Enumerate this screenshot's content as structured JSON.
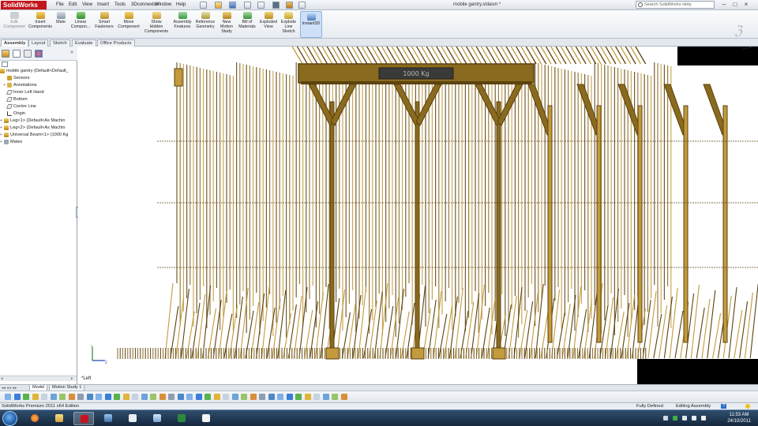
{
  "app": {
    "logo_text": "SolidWorks",
    "document_title": "mobile gantry.sldasm *",
    "menu": [
      "File",
      "Edit",
      "View",
      "Insert",
      "Tools",
      "3Dconnexion",
      "Window",
      "Help"
    ],
    "search_placeholder": "Search SolidWorks Help"
  },
  "ribbon": {
    "commands": [
      {
        "label": "Edit\nComponent",
        "disabled": true
      },
      {
        "label": "Insert\nComponents"
      },
      {
        "label": "Mate"
      },
      {
        "label": "Linear\nCompon..."
      },
      {
        "label": "Smart\nFasteners"
      },
      {
        "label": "Move\nComponent"
      },
      {
        "label": "Show\nHidden\nComponents"
      },
      {
        "label": "Assembly\nFeatures"
      },
      {
        "label": "Reference\nGeometry"
      },
      {
        "label": "New\nMotion\nStudy"
      },
      {
        "label": "Bill of\nMaterials"
      },
      {
        "label": "Exploded\nView"
      },
      {
        "label": "Explode\nLine\nSketch"
      },
      {
        "label": "Instant3D",
        "active": true
      }
    ]
  },
  "command_tabs": [
    "Assembly",
    "Layout",
    "Sketch",
    "Evaluate",
    "Office Products"
  ],
  "feature_tree": {
    "root": "mobile gantry  (Default<Default_",
    "items": [
      {
        "label": "Sensors",
        "icon": "sensor-icon",
        "expand": ""
      },
      {
        "label": "Annotations",
        "icon": "annotation-icon",
        "expand": "+"
      },
      {
        "label": "Inner Left Hand",
        "icon": "plane-icon",
        "expand": ""
      },
      {
        "label": "Bottom",
        "icon": "plane-icon",
        "expand": ""
      },
      {
        "label": "Centre Line",
        "icon": "plane-icon",
        "expand": ""
      },
      {
        "label": "Origin",
        "icon": "origin-icon",
        "expand": ""
      },
      {
        "label": "Leg<1> (Default<As Machin",
        "icon": "part-icon",
        "expand": "+"
      },
      {
        "label": "Leg<2> (Default<As Machin",
        "icon": "part-icon",
        "expand": "+"
      },
      {
        "label": "Universal Beam<1> (1000 Kg",
        "icon": "part-icon",
        "expand": "+"
      },
      {
        "label": "Mates",
        "icon": "mates-icon",
        "expand": "+"
      }
    ]
  },
  "viewport": {
    "view_name": "*Left",
    "beam_label": "1000 Kg"
  },
  "model_tabs": [
    "Model",
    "Motion Study 1"
  ],
  "status": {
    "edition": "SolidWorks Premium 2011 x64 Edition",
    "state": "Fully Defined",
    "mode": "Editing Assembly",
    "help": "?"
  },
  "taskbar": {
    "time": "11:53 AM",
    "date": "24/10/2011"
  },
  "colors": {
    "steel": "#8a6a1e",
    "steel_dark": "#5b4310",
    "steel_light": "#c39a3c",
    "accent_red": "#c4161c"
  }
}
